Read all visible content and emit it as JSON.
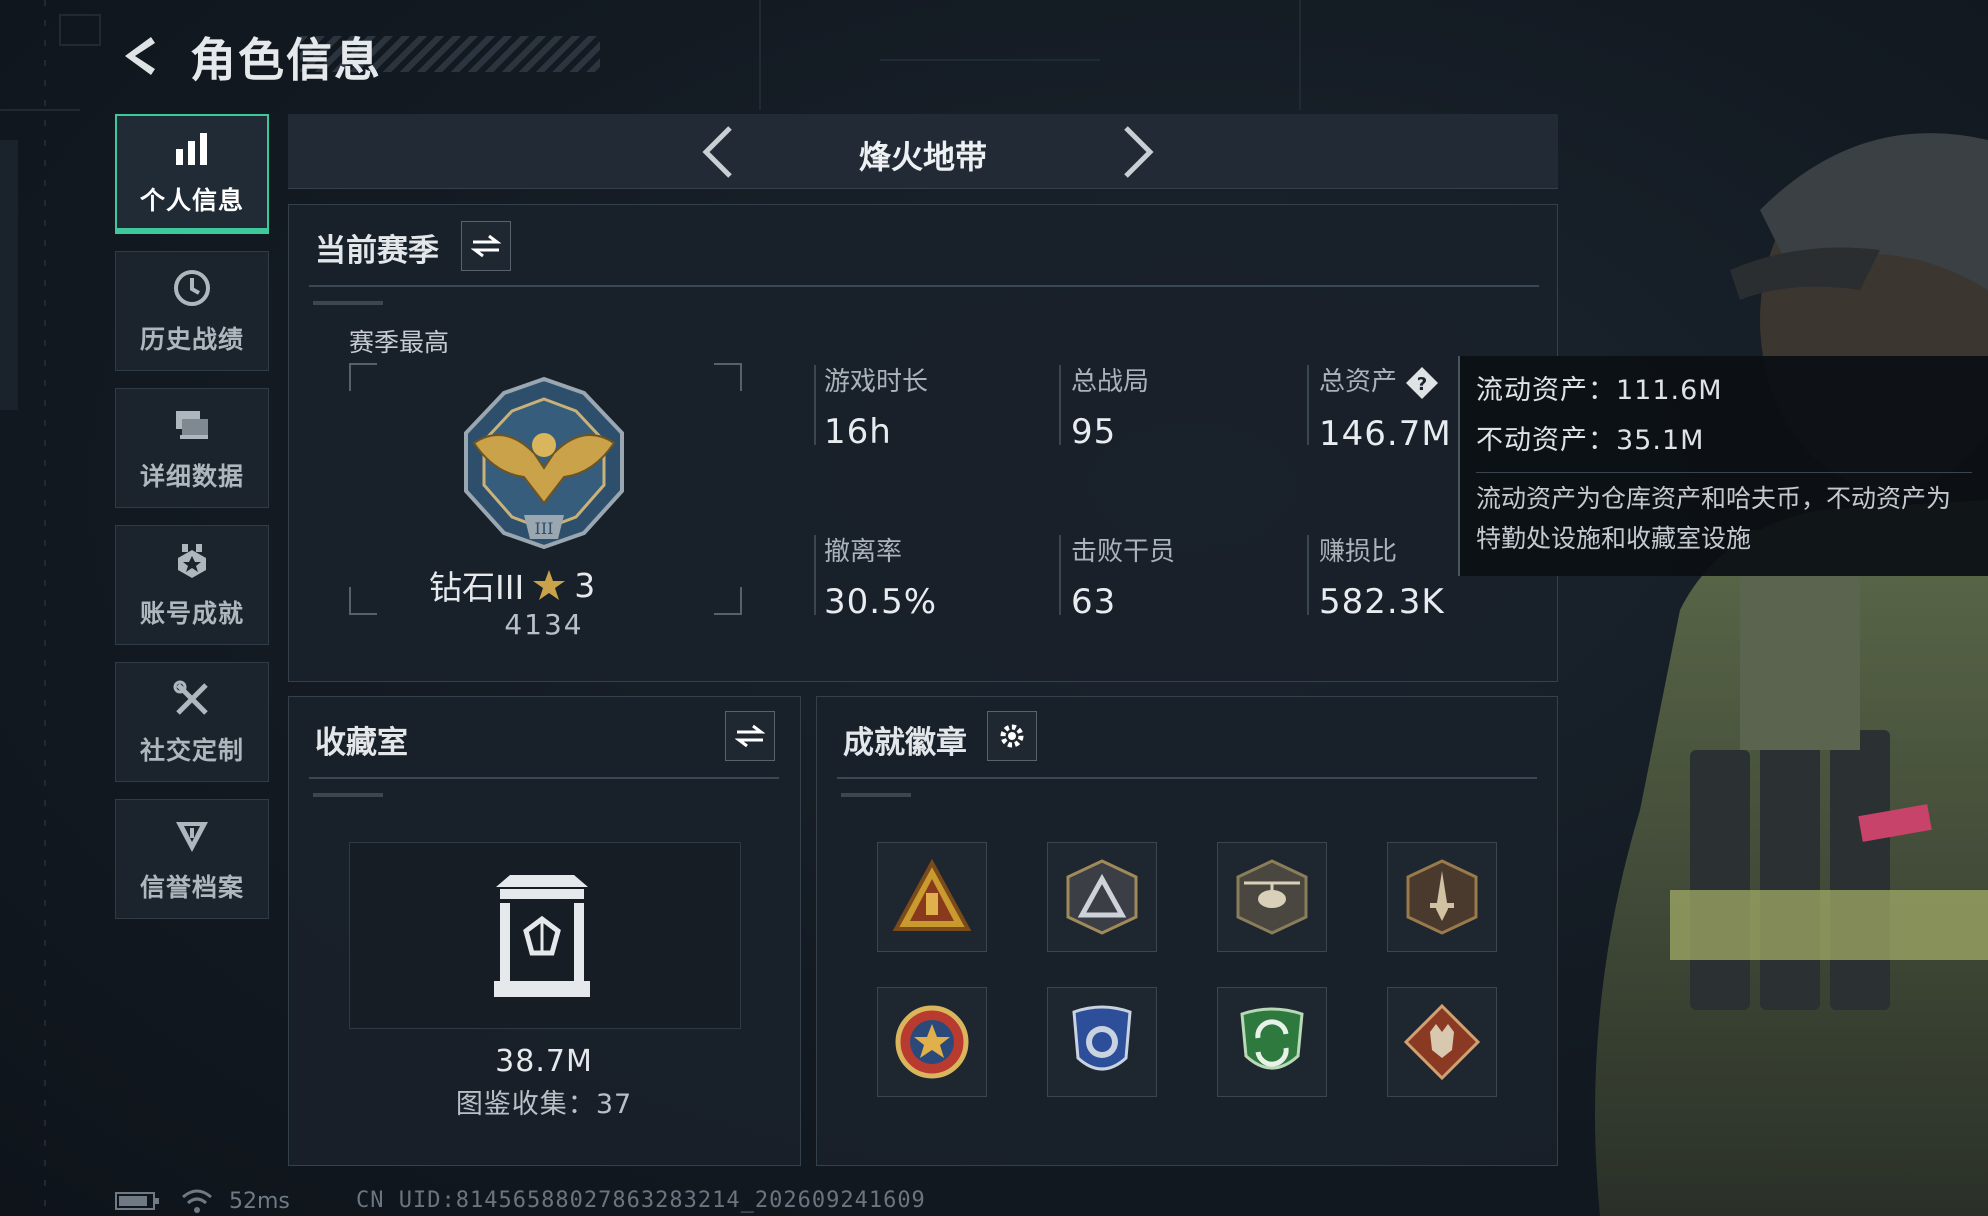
{
  "header": {
    "title": "角色信息"
  },
  "side_nav": {
    "items": [
      {
        "label": "个人信息",
        "icon": "bar-chart-icon",
        "active": true
      },
      {
        "label": "历史战绩",
        "icon": "clock-icon",
        "active": false
      },
      {
        "label": "详细数据",
        "icon": "stack-icon",
        "active": false
      },
      {
        "label": "账号成就",
        "icon": "achievement-icon",
        "active": false
      },
      {
        "label": "社交定制",
        "icon": "tools-icon",
        "active": false
      },
      {
        "label": "信誉档案",
        "icon": "shield-icon",
        "active": false
      }
    ]
  },
  "mode_selector": {
    "current": "烽火地带"
  },
  "season": {
    "title": "当前赛季",
    "peak_label": "赛季最高",
    "rank_name": "钻石III",
    "rank_stars": "3",
    "rank_score": "4134",
    "stats": [
      {
        "label": "游戏时长",
        "value": "16h"
      },
      {
        "label": "总战局",
        "value": "95"
      },
      {
        "label": "总资产",
        "value": "146.7M"
      },
      {
        "label": "撤离率",
        "value": "30.5%"
      },
      {
        "label": "击败干员",
        "value": "63"
      },
      {
        "label": "赚损比",
        "value": "582.3K"
      }
    ]
  },
  "asset_tooltip": {
    "liquid": "流动资产：111.6M",
    "fixed": "不动资产：35.1M",
    "note": "流动资产为仓库资产和哈夫币，不动资产为特勤处设施和收藏室设施"
  },
  "collection": {
    "title": "收藏室",
    "value": "38.7M",
    "count_label": "图鉴收集：",
    "count": "37"
  },
  "badges": {
    "title": "成就徽章",
    "items": [
      {
        "icon": "triangle-badge-icon"
      },
      {
        "icon": "mountain-badge-icon"
      },
      {
        "icon": "helicopter-badge-icon"
      },
      {
        "icon": "dagger-badge-icon"
      },
      {
        "icon": "star-medal-badge-icon"
      },
      {
        "icon": "police-shield-badge-icon"
      },
      {
        "icon": "green-arrows-badge-icon"
      },
      {
        "icon": "wolf-diamond-badge-icon"
      }
    ]
  },
  "footer": {
    "latency": "52ms",
    "uid": "CN UID:81456588027863283214_202609241609"
  },
  "colors": {
    "accent": "#3fc99a",
    "panel": "#19212a",
    "background": "#131a22"
  }
}
